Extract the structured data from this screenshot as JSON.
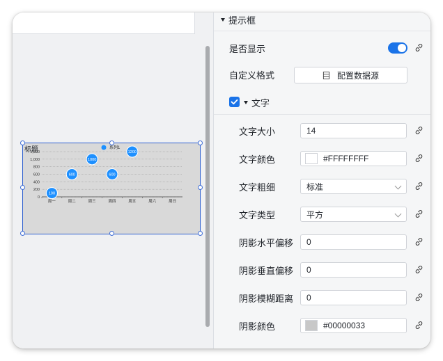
{
  "canvas": {
    "chart": {
      "title": "标题",
      "legend": "系列1",
      "y_ticks": [
        "1,200",
        "1,000",
        "800",
        "600",
        "400",
        "200",
        "0"
      ],
      "colors": {
        "point": "#1e90ff",
        "frame": "#2d5fcf",
        "background": "#d9d9d9"
      }
    }
  },
  "chart_data": {
    "type": "scatter",
    "title": "标题",
    "categories": [
      "周一",
      "周二",
      "周三",
      "周四",
      "周五",
      "周六",
      "周日"
    ],
    "series": [
      {
        "name": "系列1",
        "values": [
          100,
          600,
          1000,
          600,
          1200,
          null,
          null
        ]
      }
    ],
    "data_labels": [
      "100",
      "600",
      "1000",
      "600",
      "1200"
    ],
    "ylim": [
      0,
      1200
    ],
    "grid": true,
    "legend_position": "top-center"
  },
  "panel": {
    "section_title": "提示框",
    "show_label": "是否显示",
    "show_enabled": true,
    "custom_format_label": "自定义格式",
    "datasource_button": "配置数据源",
    "text_section_title": "文字",
    "text_checked": true,
    "fields": {
      "font_size": {
        "label": "文字大小",
        "value": "14"
      },
      "font_color": {
        "label": "文字颜色",
        "value": "#FFFFFFFF",
        "swatch": "#FFFFFF"
      },
      "font_weight": {
        "label": "文字粗细",
        "value": "标准"
      },
      "font_type": {
        "label": "文字类型",
        "value": "平方"
      },
      "shadow_x": {
        "label": "阴影水平偏移",
        "value": "0"
      },
      "shadow_y": {
        "label": "阴影垂直偏移",
        "value": "0"
      },
      "shadow_blur": {
        "label": "阴影模糊距离",
        "value": "0"
      },
      "shadow_color": {
        "label": "阴影颜色",
        "value": "#00000033",
        "swatch": "#c8c8c8"
      }
    },
    "colors": {
      "accent": "#1a73e8"
    },
    "icons": {
      "link": "link-icon",
      "datasource": "table-icon",
      "check": "check-icon"
    }
  }
}
